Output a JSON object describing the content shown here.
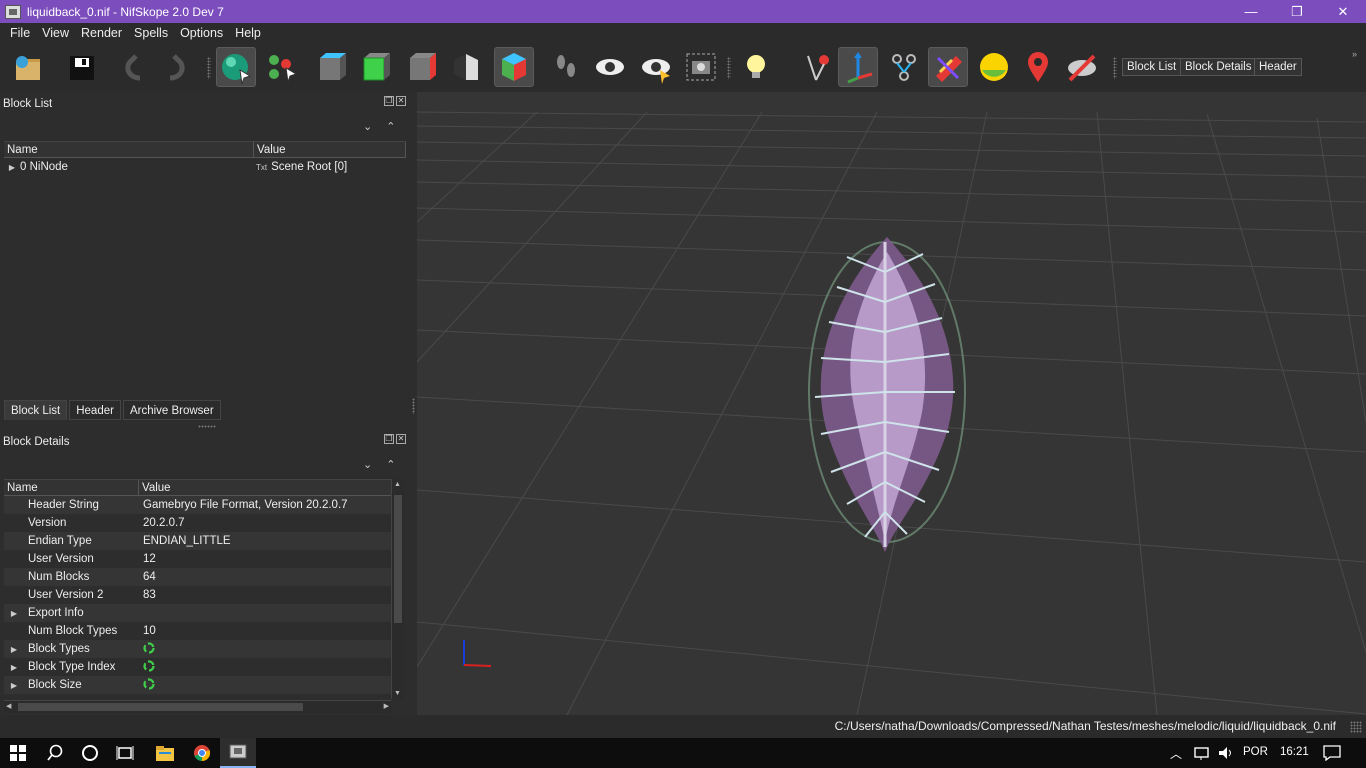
{
  "window": {
    "title": "liquidback_0.nif - NifSkope 2.0 Dev 7",
    "controls": [
      "—",
      "❐",
      "✕"
    ]
  },
  "menu": [
    "File",
    "View",
    "Render",
    "Spells",
    "Options",
    "Help"
  ],
  "toolbar": {
    "tabs": [
      "Block List",
      "Block Details",
      "Header"
    ]
  },
  "block_list": {
    "title": "Block List",
    "columns": [
      "Name",
      "Value"
    ],
    "rows": [
      {
        "name": "0 NiNode",
        "value": "Scene Root [0]",
        "value_icon": "Txt"
      }
    ]
  },
  "left_tabs": [
    "Block List",
    "Header",
    "Archive Browser"
  ],
  "block_details": {
    "title": "Block Details",
    "columns": [
      "Name",
      "Value"
    ],
    "rows": [
      {
        "name": "Header String",
        "value": "Gamebryo File Format, Version 20.2.0.7",
        "expandable": false
      },
      {
        "name": "Version",
        "value": "20.2.0.7",
        "expandable": false
      },
      {
        "name": "Endian Type",
        "value": "ENDIAN_LITTLE",
        "expandable": false
      },
      {
        "name": "User Version",
        "value": "12",
        "expandable": false
      },
      {
        "name": "Num Blocks",
        "value": "64",
        "expandable": false
      },
      {
        "name": "User Version 2",
        "value": "83",
        "expandable": false
      },
      {
        "name": "Export Info",
        "value": "",
        "expandable": true
      },
      {
        "name": "Num Block Types",
        "value": "10",
        "expandable": false
      },
      {
        "name": "Block Types",
        "value": "",
        "expandable": true,
        "icon": true
      },
      {
        "name": "Block Type Index",
        "value": "",
        "expandable": true,
        "icon": true
      },
      {
        "name": "Block Size",
        "value": "",
        "expandable": true,
        "icon": true
      }
    ]
  },
  "statusbar": {
    "path": "C:/Users/natha/Downloads/Compressed/Nathan Testes/meshes/melodic/liquid/liquidback_0.nif"
  },
  "taskbar": {
    "language": "POR",
    "time": "16:21"
  }
}
